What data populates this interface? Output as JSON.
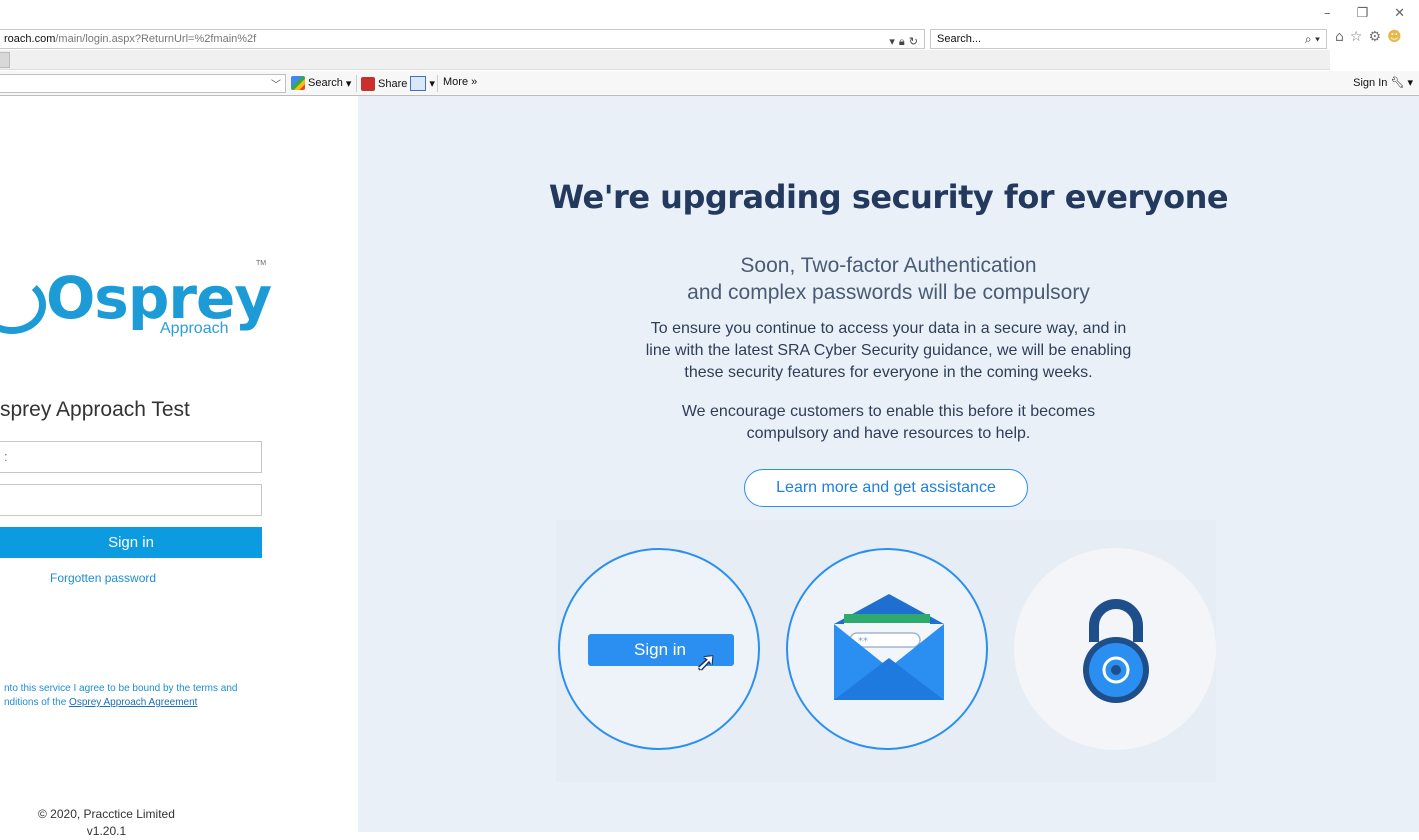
{
  "browser": {
    "url": "roach.com/main/login.aspx?ReturnUrl=%2fmain%2f",
    "url_domain": "roach.com",
    "url_path": "/main/login.aspx?ReturnUrl=%2fmain%2f",
    "search_placeholder": "Search...",
    "toolbar": {
      "search_label": "Search",
      "share_label": "Share",
      "more_label": "More »",
      "sign_in_label": "Sign In"
    }
  },
  "login": {
    "logo_text": "Osprey",
    "logo_sub": "Approach",
    "logo_tm": "TM",
    "site_title": "sprey Approach Test",
    "username_value": ":",
    "password_value": "",
    "sign_in_label": "Sign in",
    "forgot_label": "Forgotten password",
    "terms_line1": "nto this service I agree to be bound by the terms and",
    "terms_line2_prefix": "nditions of the ",
    "terms_link": "Osprey Approach Agreement",
    "copyright": "© 2020, Pracctice Limited",
    "version": "v1.20.1"
  },
  "promo": {
    "title": "We're upgrading security for everyone",
    "subtitle_line1": "Soon, Two-factor Authentication",
    "subtitle_line2": "and complex passwords will be compulsory",
    "body1_line1": "To ensure you continue to access your data in a secure way, and in",
    "body1_line2": "line with the latest SRA Cyber Security guidance, we will be enabling",
    "body1_line3": "these security features for everyone in the coming weeks.",
    "body2_line1": "We encourage customers to enable this before it becomes",
    "body2_line2": "compulsory and have resources to help.",
    "learn_more_label": "Learn more and get assistance",
    "illus_button_label": "Sign in",
    "illus_password_mask": "**"
  },
  "colors": {
    "brand_blue": "#1c9bd6",
    "signin_button": "#0c9be0",
    "promo_bg": "#eaf0f7",
    "title_navy": "#23395d",
    "accent_blue": "#2a8ff0"
  }
}
